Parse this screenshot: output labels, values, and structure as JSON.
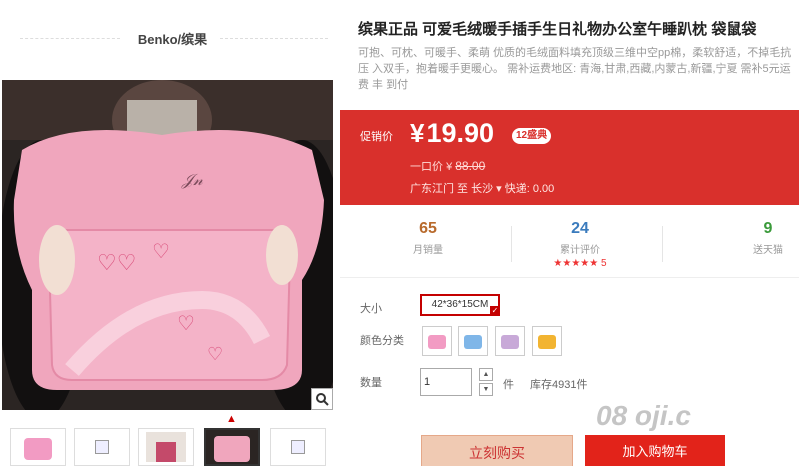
{
  "brand": "Benko/缤果",
  "product": {
    "title": "缤果正品 可爱毛绒暖手插手生日礼物办公室午睡趴枕 袋鼠袋",
    "description": "可抱、可枕、可暖手、柔萌 优质的毛绒面料填充顶级三维中空pp棉，柔软舒适，不掉毛抗压 入双手，抱着暖手更暖心。 需补运费地区: 青海,甘肃,西藏,内蒙古,新疆,宁夏 需补5元运费 丰 到付"
  },
  "price": {
    "label": "促销价",
    "currency": "¥",
    "value": "19.90",
    "badge": "12盛典",
    "orig_label": "一口价",
    "orig_currency": "¥",
    "orig_value": "88.00",
    "shipping": "广东江门 至  长沙 ▾  快递: 0.00"
  },
  "stats": [
    {
      "num": "65",
      "label": "月销量",
      "color": "#b86a2c"
    },
    {
      "num": "24",
      "label": "累计评价",
      "stars": "★★★★★  5",
      "color": "#3a7bbd"
    },
    {
      "num": "9",
      "label": "送天猫",
      "color": "#3a9a3a"
    }
  ],
  "options": {
    "size_label": "大小",
    "size_value": "42*36*15CM",
    "color_label": "颜色分类",
    "colors": [
      "#f29bc3",
      "#7fb6e8",
      "#c8a9d8",
      "#f2b431"
    ],
    "qty_label": "数量",
    "qty_value": "1",
    "qty_unit": "件",
    "stock": "库存4931件"
  },
  "buttons": {
    "buy_now": "立刻购买",
    "add_cart": "加入购物车"
  },
  "watermark": "08 oji.c"
}
